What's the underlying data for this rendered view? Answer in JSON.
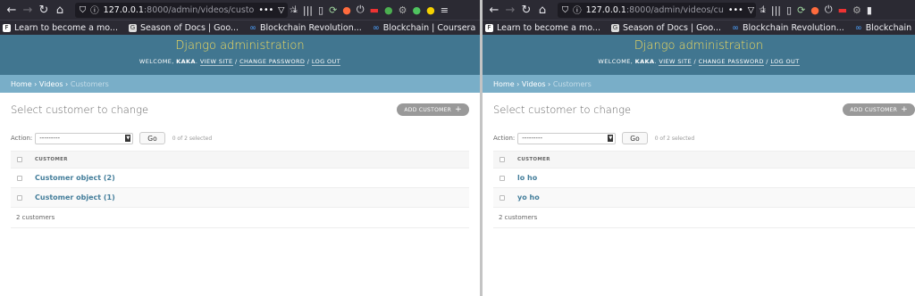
{
  "browser": {
    "url_host": "127.0.0.1",
    "url_rest": ":8000/admin/videos/custo",
    "url_rest_right": ":8000/admin/videos/cu",
    "bookmarks": [
      {
        "label": "Learn to become a mo...",
        "icon": "freecodecamp-icon"
      },
      {
        "label": "Season of Docs | Goo...",
        "icon": "google-icon"
      },
      {
        "label": "Blockchain Revolution...",
        "icon": "coursera-icon"
      },
      {
        "label": "Blockchain | Coursera",
        "icon": "coursera-icon"
      }
    ]
  },
  "admin": {
    "site_title": "Django administration",
    "welcome": "WELCOME,",
    "username": "KAKA",
    "view_site": "VIEW SITE",
    "change_password": "CHANGE PASSWORD",
    "log_out": "LOG OUT",
    "sep": " / ",
    "breadcrumbs": {
      "home": "Home",
      "app": "Videos",
      "current": "Customers",
      "sep": " › "
    },
    "page_title": "Select customer to change",
    "add_button": "ADD CUSTOMER",
    "action_label": "Action:",
    "action_selected": "---------",
    "go_button": "Go",
    "selected_count": "0 of 2 selected",
    "column_header": "CUSTOMER",
    "paginator": "2 customers"
  },
  "left": {
    "rows": [
      "Customer object (2)",
      "Customer object (1)"
    ]
  },
  "right": {
    "rows": [
      "lo ho",
      "yo ho"
    ]
  },
  "colors": {
    "header": "#417690",
    "title": "#f5dd5d",
    "breadcrumbs": "#79aec8",
    "link": "#447e9b"
  }
}
